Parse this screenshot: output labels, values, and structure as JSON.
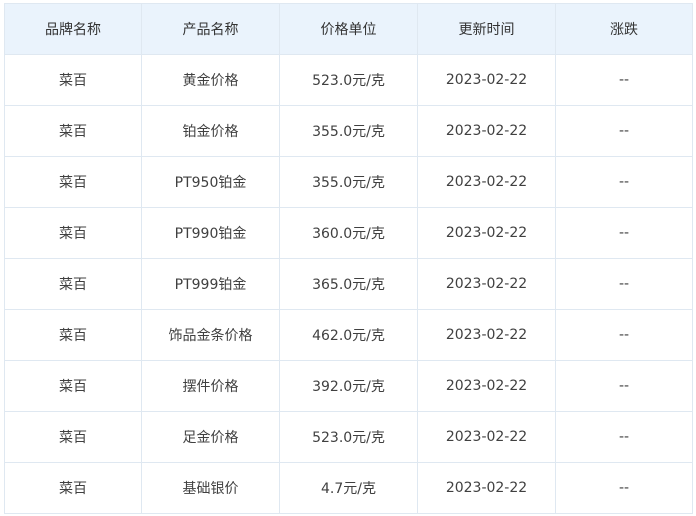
{
  "table": {
    "headers": [
      "品牌名称",
      "产品名称",
      "价格单位",
      "更新时间",
      "涨跌"
    ],
    "rows": [
      [
        "菜百",
        "黄金价格",
        "523.0元/克",
        "2023-02-22",
        "--"
      ],
      [
        "菜百",
        "铂金价格",
        "355.0元/克",
        "2023-02-22",
        "--"
      ],
      [
        "菜百",
        "PT950铂金",
        "355.0元/克",
        "2023-02-22",
        "--"
      ],
      [
        "菜百",
        "PT990铂金",
        "360.0元/克",
        "2023-02-22",
        "--"
      ],
      [
        "菜百",
        "PT999铂金",
        "365.0元/克",
        "2023-02-22",
        "--"
      ],
      [
        "菜百",
        "饰品金条价格",
        "462.0元/克",
        "2023-02-22",
        "--"
      ],
      [
        "菜百",
        "摆件价格",
        "392.0元/克",
        "2023-02-22",
        "--"
      ],
      [
        "菜百",
        "足金价格",
        "523.0元/克",
        "2023-02-22",
        "--"
      ],
      [
        "菜百",
        "基础银价",
        "4.7元/克",
        "2023-02-22",
        "--"
      ]
    ]
  },
  "colors": {
    "header_background": "#eaf3fc",
    "border": "#dfe8f1",
    "text": "#404040"
  }
}
